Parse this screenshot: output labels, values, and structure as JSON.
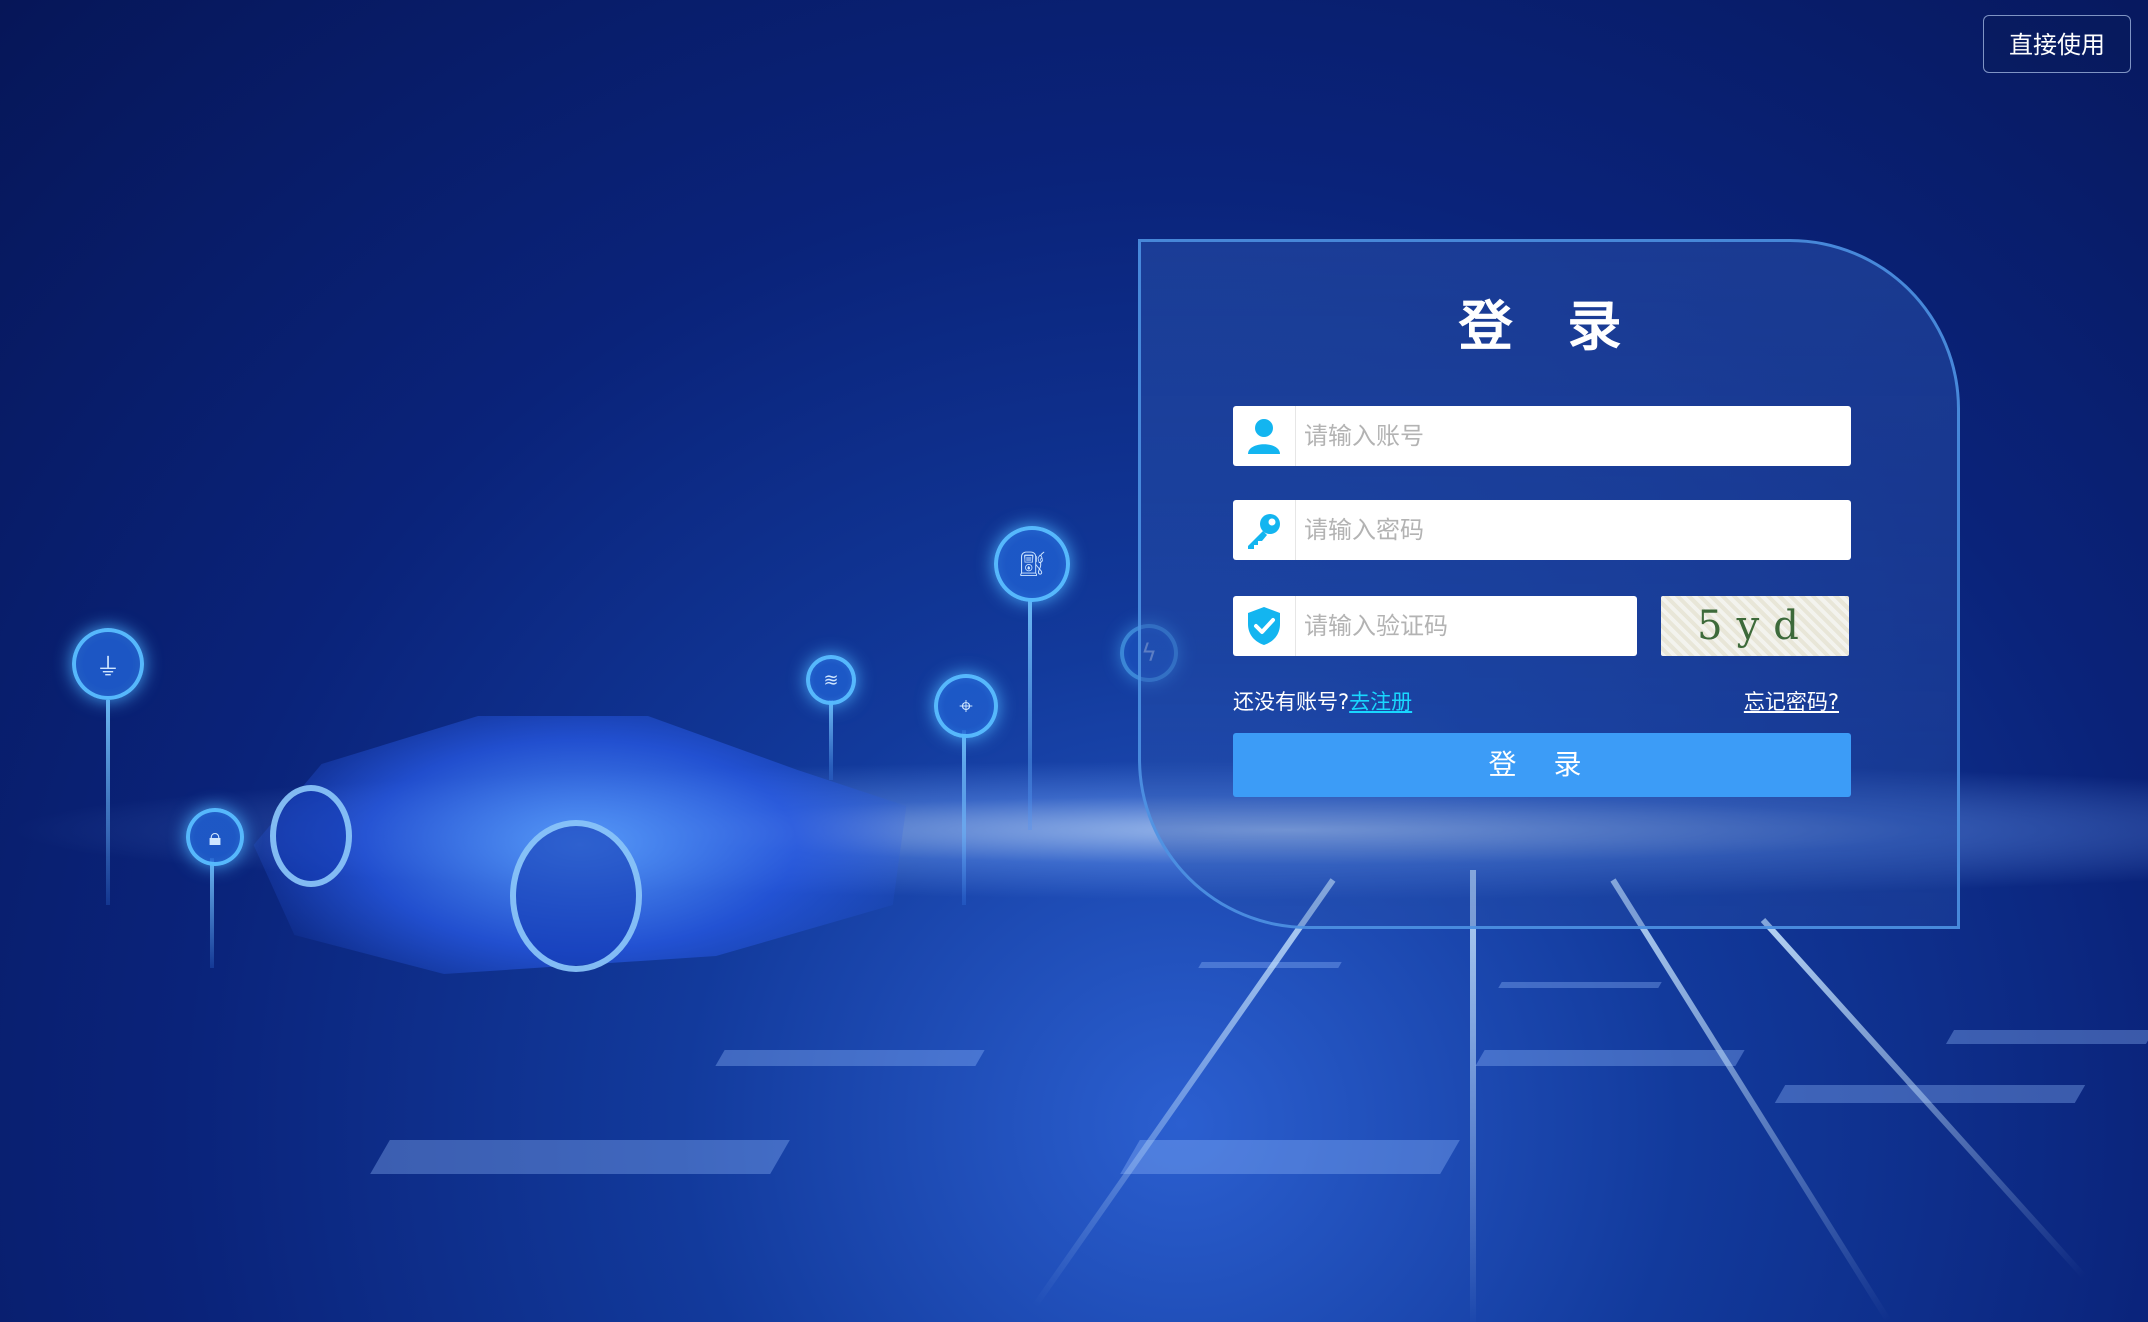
{
  "header": {
    "direct_use_label": "直接使用"
  },
  "login": {
    "title": "登 录",
    "username": {
      "placeholder": "请输入账号",
      "value": ""
    },
    "password": {
      "placeholder": "请输入密码",
      "value": ""
    },
    "captcha": {
      "placeholder": "请输入验证码",
      "value": "",
      "image_text": "5yd"
    },
    "no_account_text": "还没有账号?",
    "register_link": "去注册",
    "forgot_link": "忘记密码?",
    "submit_label": "登 录"
  },
  "colors": {
    "accent": "#3c9cf7",
    "link": "#19d7ff",
    "icon": "#13b5f0",
    "background": "#0a237a"
  },
  "icons": [
    "user-icon",
    "key-icon",
    "shield-check-icon"
  ]
}
